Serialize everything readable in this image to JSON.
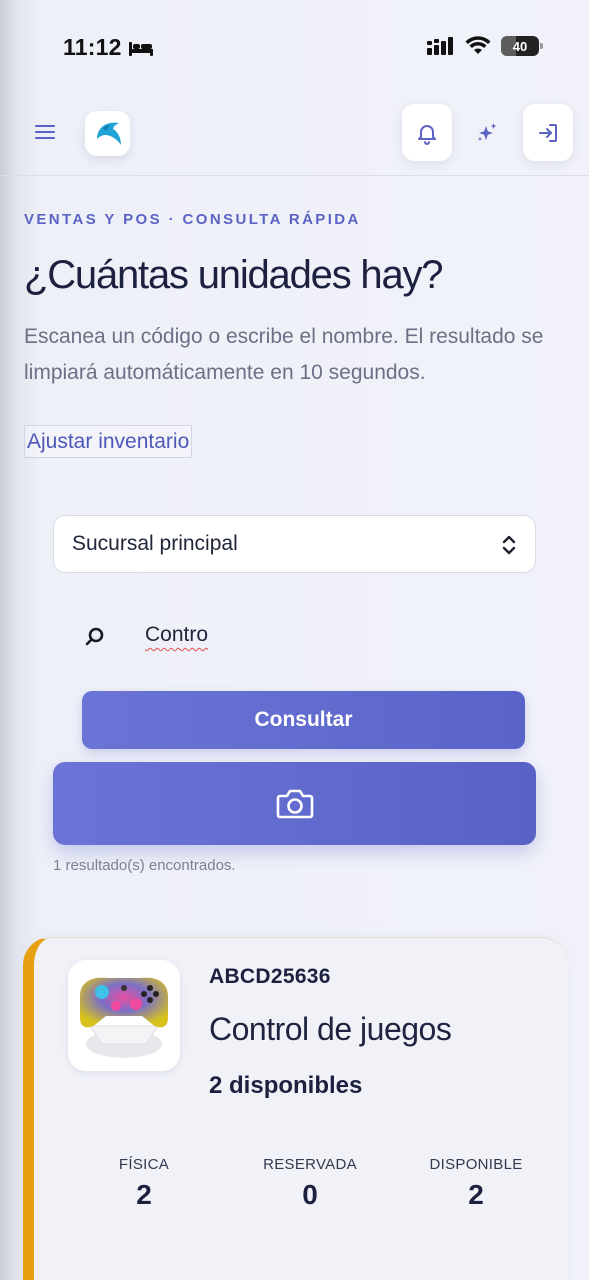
{
  "status_bar": {
    "time": "11:12",
    "battery": "40"
  },
  "header": {
    "eyebrow": "VENTAS Y POS · CONSULTA RÁPIDA",
    "title": "¿Cuántas unidades hay?",
    "description": "Escanea un código o escribe el nombre. El resultado se limpiará automáticamente en 10 segundos.",
    "adjust_link": "Ajustar inventario"
  },
  "form": {
    "branch_selected": "Sucursal principal",
    "search_value": "Contro",
    "consult_button": "Consultar"
  },
  "results": {
    "count_text": "1 resultado(s) encontrados.",
    "items": [
      {
        "sku": "ABCD25636",
        "name": "Control de juegos",
        "available_text": "2 disponibles",
        "stats": [
          {
            "label": "FÍSICA",
            "value": "2"
          },
          {
            "label": "RESERVADA",
            "value": "0"
          },
          {
            "label": "DISPONIBLE",
            "value": "2"
          }
        ]
      }
    ]
  },
  "colors": {
    "accent": "#5b64c4",
    "button": "#6068cc",
    "card_border": "#e8a013"
  }
}
